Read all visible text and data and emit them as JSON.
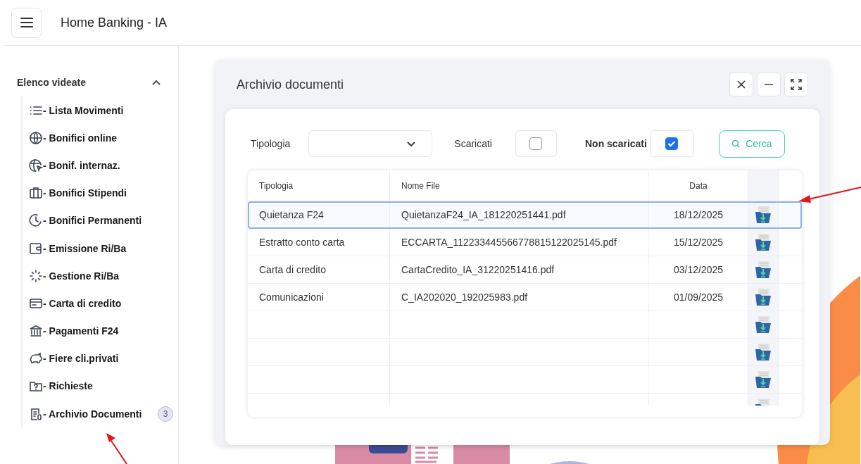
{
  "header": {
    "title": "Home Banking - IA"
  },
  "sidebar": {
    "section_title": "Elenco videate",
    "expanded": true,
    "items": [
      {
        "label": "- Lista Movimenti"
      },
      {
        "label": "- Bonifici online"
      },
      {
        "label": "- Bonif. internaz."
      },
      {
        "label": "- Bonifici Stipendi"
      },
      {
        "label": "- Bonifici Permanenti"
      },
      {
        "label": "- Emissione Ri/Ba"
      },
      {
        "label": "- Gestione Ri/Ba"
      },
      {
        "label": "- Carta di credito"
      },
      {
        "label": "- Pagamenti F24"
      },
      {
        "label": "- Fiere cli.privati"
      },
      {
        "label": "- Richieste"
      },
      {
        "label": "- Archivio Documenti",
        "badge": "3"
      }
    ]
  },
  "dialog": {
    "title": "Archivio documenti",
    "filters": {
      "tipologia_label": "Tipologia",
      "scaricati_label": "Scaricati",
      "scaricati_checked": false,
      "non_scaricati_label": "Non scaricati",
      "non_scaricati_checked": true,
      "search_button": "Cerca"
    },
    "table": {
      "columns": [
        "Tipologia",
        "Nome File",
        "Data"
      ],
      "rows": [
        {
          "tipologia": "Quietanza F24",
          "nome_file": "QuietanzaF24_IA_181220251441.pdf",
          "data": "18/12/2025",
          "selected": true
        },
        {
          "tipologia": "Estratto conto carta",
          "nome_file": "ECCARTA_112233445566778815122025145.pdf",
          "data": "15/12/2025",
          "selected": false
        },
        {
          "tipologia": "Carta di credito",
          "nome_file": "CartaCredito_IA_31220251416.pdf",
          "data": "03/12/2025",
          "selected": false
        },
        {
          "tipologia": "Comunicazioni",
          "nome_file": "C_IA202020_192025983.pdf",
          "data": "01/09/2025",
          "selected": false
        }
      ]
    }
  }
}
